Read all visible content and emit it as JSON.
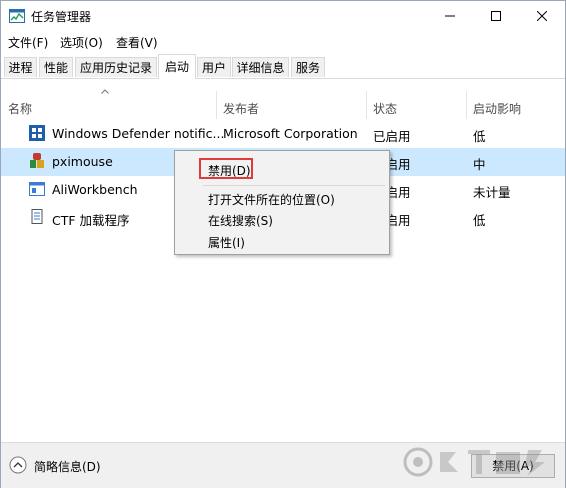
{
  "window": {
    "title": "任务管理器"
  },
  "menubar": [
    "文件(F)",
    "选项(O)",
    "查看(V)"
  ],
  "tabs": [
    {
      "label": "进程"
    },
    {
      "label": "性能"
    },
    {
      "label": "应用历史记录"
    },
    {
      "label": "启动",
      "active": true
    },
    {
      "label": "用户"
    },
    {
      "label": "详细信息"
    },
    {
      "label": "服务"
    }
  ],
  "columns": {
    "name": "名称",
    "publisher": "发布者",
    "status": "状态",
    "impact": "启动影响"
  },
  "rows": [
    {
      "name": "Windows Defender notific...",
      "publisher": "Microsoft Corporation",
      "status": "已启用",
      "impact": "低",
      "icon": "shield-icon"
    },
    {
      "name": "pximouse",
      "publisher": "",
      "status": "已启用",
      "impact": "中",
      "icon": "pximouse-app-icon",
      "selected": true
    },
    {
      "name": "AliWorkbench",
      "publisher": "",
      "status": "已启用",
      "impact": "未计量",
      "icon": "window-app-icon"
    },
    {
      "name": "CTF 加载程序",
      "publisher": "",
      "status": "已启用",
      "impact": "低",
      "icon": "ctf-loader-icon"
    }
  ],
  "context_menu": {
    "items": [
      "禁用(D)",
      "打开文件所在的位置(O)",
      "在线搜索(S)",
      "属性(I)"
    ],
    "highlight_color": "#e03a3a"
  },
  "bottom": {
    "summary": "简略信息(D)",
    "disable_button": "禁用(A)"
  },
  "colors": {
    "selection": "#cce8ff",
    "accent": "#0078d7"
  }
}
